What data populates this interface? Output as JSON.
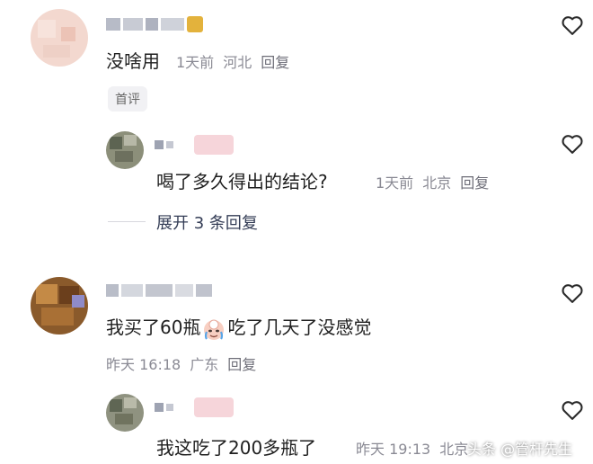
{
  "comments": [
    {
      "text": "没啥用",
      "time": "1天前",
      "location": "河北",
      "reply_label": "回复",
      "badge": "首评"
    },
    {
      "text": "喝了多久得出的结论?",
      "time": "1天前",
      "location": "北京",
      "reply_label": "回复"
    },
    {
      "text_before": "我买了60瓶",
      "text_after": "吃了几天了没感觉",
      "time": "昨天 16:18",
      "location": "广东",
      "reply_label": "回复"
    },
    {
      "text": "我这吃了200多瓶了",
      "time": "昨天 19:13",
      "location": "北京"
    }
  ],
  "expand_replies_label": "展开 3 条回复",
  "watermark": "头条 @管杆先生",
  "icons": {
    "like": "heart-outline-icon",
    "emoji": "crying-face-emoji-icon"
  },
  "colors": {
    "meta": "#8a8a94",
    "text": "#1f1f1f",
    "expand": "#333c55"
  }
}
